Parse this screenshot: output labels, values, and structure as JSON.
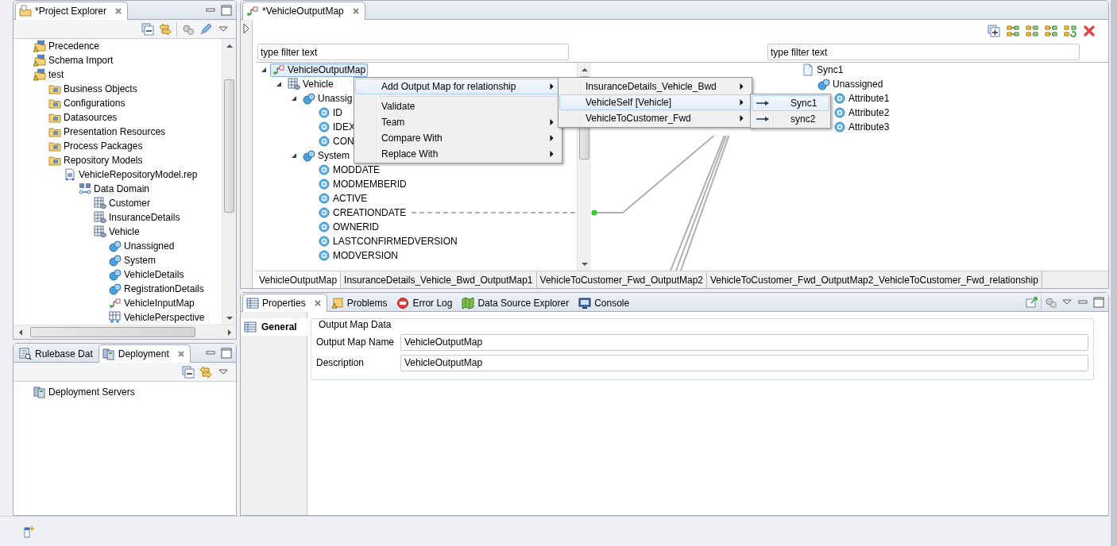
{
  "project_explorer": {
    "tab": {
      "label": "*Project Explorer"
    },
    "tree": [
      {
        "label": "Precedence",
        "kind": "project"
      },
      {
        "label": "Schema Import",
        "kind": "project"
      },
      {
        "label": "test",
        "kind": "project",
        "children": [
          {
            "label": "Business Objects",
            "kind": "folder"
          },
          {
            "label": "Configurations",
            "kind": "folder"
          },
          {
            "label": "Datasources",
            "kind": "folder"
          },
          {
            "label": "Presentation Resources",
            "kind": "folder"
          },
          {
            "label": "Process Packages",
            "kind": "folder"
          },
          {
            "label": "Repository Models",
            "kind": "folder",
            "children": [
              {
                "label": "VehicleRepositoryModel.rep",
                "kind": "model",
                "children": [
                  {
                    "label": "Data Domain",
                    "kind": "domain",
                    "children": [
                      {
                        "label": "Customer",
                        "kind": "table"
                      },
                      {
                        "label": "InsuranceDetails",
                        "kind": "table"
                      },
                      {
                        "label": "Vehicle",
                        "kind": "table",
                        "children": [
                          {
                            "label": "Unassigned",
                            "kind": "group"
                          },
                          {
                            "label": "System",
                            "kind": "group"
                          },
                          {
                            "label": "VehicleDetails",
                            "kind": "group"
                          },
                          {
                            "label": "RegistrationDetails",
                            "kind": "group"
                          },
                          {
                            "label": "VehicleInputMap",
                            "kind": "map"
                          },
                          {
                            "label": "VehiclePerspective",
                            "kind": "perspective"
                          }
                        ]
                      }
                    ]
                  }
                ]
              }
            ]
          }
        ]
      }
    ]
  },
  "deployment_panel": {
    "tabs": [
      {
        "label": "Rulebase Dat",
        "kind": "rulebase",
        "selected": false
      },
      {
        "label": "Deployment",
        "kind": "server",
        "selected": true
      }
    ],
    "tree": [
      {
        "label": "Deployment Servers",
        "kind": "server"
      }
    ]
  },
  "editor": {
    "tab": {
      "label": "*VehicleOutputMap"
    },
    "source": {
      "filter": {
        "placeholder": "type filter text"
      },
      "tree": [
        {
          "label": "VehicleOutputMap",
          "kind": "map",
          "selected": true,
          "expanded": true,
          "children": [
            {
              "label": "Vehicle",
              "kind": "table",
              "selected": false,
              "expanded": true,
              "children": [
                {
                  "label": "Unassig",
                  "kind": "group",
                  "selected": false,
                  "expanded": true,
                  "children": [
                    {
                      "label": "ID",
                      "kind": "attribute",
                      "selected": false
                    },
                    {
                      "label": "IDEX",
                      "kind": "attribute",
                      "selected": false
                    },
                    {
                      "label": "CON",
                      "kind": "attribute",
                      "selected": false
                    }
                  ]
                },
                {
                  "label": "System",
                  "kind": "group",
                  "selected": false,
                  "expanded": true,
                  "children": [
                    {
                      "label": "MODDATE",
                      "kind": "attribute",
                      "selected": false
                    },
                    {
                      "label": "MODMEMBERID",
                      "kind": "attribute",
                      "selected": false
                    },
                    {
                      "label": "ACTIVE",
                      "kind": "attribute",
                      "selected": false
                    },
                    {
                      "label": "CREATIONDATE",
                      "kind": "attribute",
                      "selected": false
                    },
                    {
                      "label": "OWNERID",
                      "kind": "attribute",
                      "selected": false
                    },
                    {
                      "label": "LASTCONFIRMEDVERSION",
                      "kind": "attribute",
                      "selected": false
                    },
                    {
                      "label": "MODVERSION",
                      "kind": "attribute",
                      "selected": false
                    }
                  ]
                }
              ]
            }
          ]
        }
      ]
    },
    "target": {
      "filter": {
        "placeholder": "type filter text"
      },
      "tree": [
        {
          "label": "Sync1",
          "kind": "document",
          "children": [
            {
              "label": "Unassigned",
              "kind": "group",
              "children": [
                {
                  "label": "Attribute1",
                  "kind": "attribute"
                },
                {
                  "label": "Attribute2",
                  "kind": "attribute"
                },
                {
                  "label": "Attribute3",
                  "kind": "attribute"
                }
              ]
            }
          ]
        }
      ]
    },
    "bottom_tabs": [
      {
        "label": "VehicleOutputMap",
        "selected": true
      },
      {
        "label": "InsuranceDetails_Vehicle_Bwd_OutputMap1",
        "selected": false
      },
      {
        "label": "VehicleToCustomer_Fwd_OutputMap2",
        "selected": false
      },
      {
        "label": "VehicleToCustomer_Fwd_OutputMap2_VehicleToCustomer_Fwd_relationship",
        "selected": false
      }
    ]
  },
  "context_menu": {
    "items": [
      {
        "kind": "submenu",
        "label": "Add Output Map for relationship",
        "highlighted": true
      },
      {
        "kind": "separator"
      },
      {
        "kind": "action",
        "label": "Validate",
        "highlighted": false
      },
      {
        "kind": "submenu",
        "label": "Team",
        "highlighted": false
      },
      {
        "kind": "submenu",
        "label": "Compare With",
        "highlighted": false
      },
      {
        "kind": "submenu",
        "label": "Replace With",
        "highlighted": false
      }
    ]
  },
  "relationship_menu": {
    "items": [
      {
        "kind": "submenu",
        "label": "InsuranceDetails_Vehicle_Bwd",
        "highlighted": false
      },
      {
        "kind": "submenu",
        "label": "VehicleSelf [Vehicle]",
        "highlighted": true
      },
      {
        "kind": "submenu",
        "label": "VehicleToCustomer_Fwd",
        "highlighted": false
      }
    ]
  },
  "target_menu": {
    "items": [
      {
        "kind": "target",
        "label": "Sync1",
        "highlighted": true
      },
      {
        "kind": "target",
        "label": "sync2",
        "highlighted": false
      }
    ]
  },
  "properties": {
    "tabs": [
      {
        "label": "Properties",
        "kind": "properties",
        "selected": true
      },
      {
        "label": "Problems",
        "kind": "problems",
        "selected": false
      },
      {
        "label": "Error Log",
        "kind": "errorlog",
        "selected": false
      },
      {
        "label": "Data Source Explorer",
        "kind": "datasource",
        "selected": false
      },
      {
        "label": "Console",
        "kind": "console",
        "selected": false
      }
    ],
    "side_tabs": [
      {
        "label": "General",
        "selected": true
      }
    ],
    "group": {
      "title": "Output Map Data",
      "fields": [
        {
          "label": "Output Map Name",
          "value": "VehicleOutputMap"
        },
        {
          "label": "Description",
          "value": "VehicleOutputMap"
        }
      ]
    }
  }
}
